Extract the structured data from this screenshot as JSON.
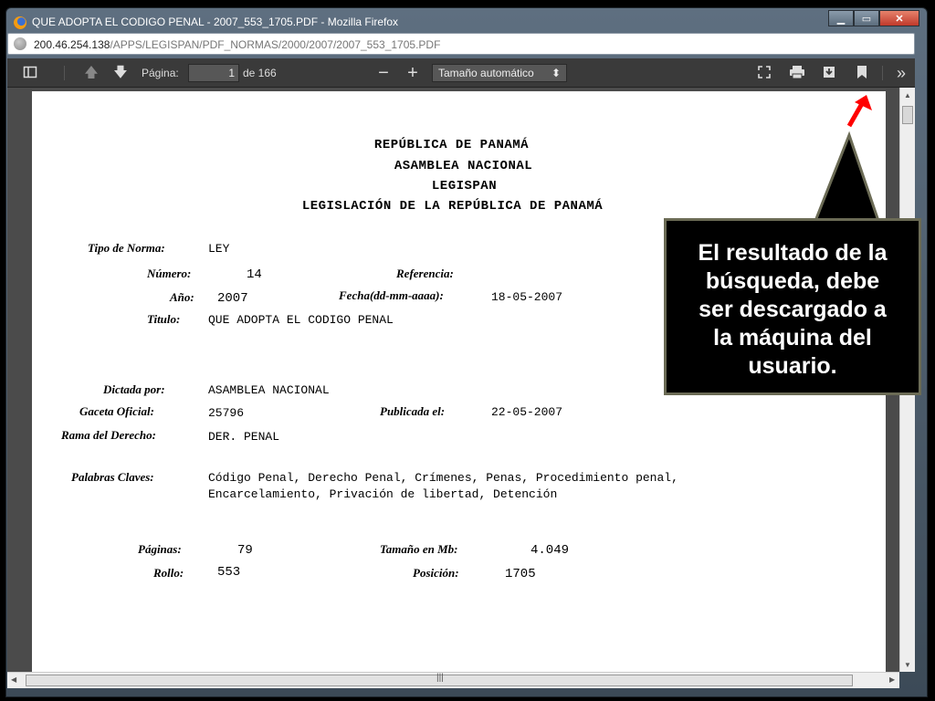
{
  "window": {
    "title": "QUE ADOPTA EL CODIGO PENAL - 2007_553_1705.PDF - Mozilla Firefox",
    "url_host": "200.46.254.138",
    "url_path": "/APPS/LEGISPAN/PDF_NORMAS/2000/2007/2007_553_1705.PDF",
    "controls": {
      "minimize": "▁",
      "maximize": "▭",
      "close": "✕"
    }
  },
  "toolbar": {
    "page_label": "Página:",
    "page_value": "1",
    "page_total": "de 166",
    "zoom_value": "Tamaño automático",
    "icons": [
      "sidebar-toggle-icon",
      "arrow-up-icon",
      "arrow-down-icon",
      "zoom-out-icon",
      "zoom-in-icon",
      "fullscreen-icon",
      "print-icon",
      "download-icon",
      "bookmark-icon",
      "tools-icon"
    ]
  },
  "document": {
    "header": [
      "REPÚBLICA DE PANAMÁ",
      "ASAMBLEA NACIONAL",
      "LEGISPAN",
      "LEGISLACIÓN DE LA REPÚBLICA DE PANAMÁ"
    ],
    "fields": {
      "tipo_label": "Tipo de Norma:",
      "tipo_value": "LEY",
      "numero_label": "Número:",
      "numero_value": "14",
      "referencia_label": "Referencia:",
      "anio_label": "Año:",
      "anio_value": "2007",
      "fecha_label": "Fecha(dd-mm-aaaa):",
      "fecha_value": "18-05-2007",
      "titulo_label": "Titulo:",
      "titulo_value": "QUE ADOPTA EL CODIGO PENAL",
      "dictada_label": "Dictada por:",
      "dictada_value": "ASAMBLEA NACIONAL",
      "gaceta_label": "Gaceta Oficial:",
      "gaceta_value": "25796",
      "publicada_label": "Publicada el:",
      "publicada_value": "22-05-2007",
      "rama_label": "Rama del Derecho:",
      "rama_value": "DER. PENAL",
      "palabras_label": "Palabras Claves:",
      "palabras_line1": "Código Penal, Derecho Penal, Crímenes, Penas, Procedimiento penal,",
      "palabras_line2": "Encarcelamiento, Privación de libertad, Detención",
      "paginas_label": "Páginas:",
      "paginas_value": "79",
      "tamano_label": "Tamaño en Mb:",
      "tamano_value": "4.049",
      "rollo_label": "Rollo:",
      "rollo_value": "553",
      "posicion_label": "Posición:",
      "posicion_value": "1705"
    }
  },
  "callout": {
    "lines": [
      "El resultado de la",
      "búsqueda, debe",
      "ser descargado a",
      "la máquina del",
      "usuario."
    ],
    "arrow_color": "#ff0000"
  }
}
